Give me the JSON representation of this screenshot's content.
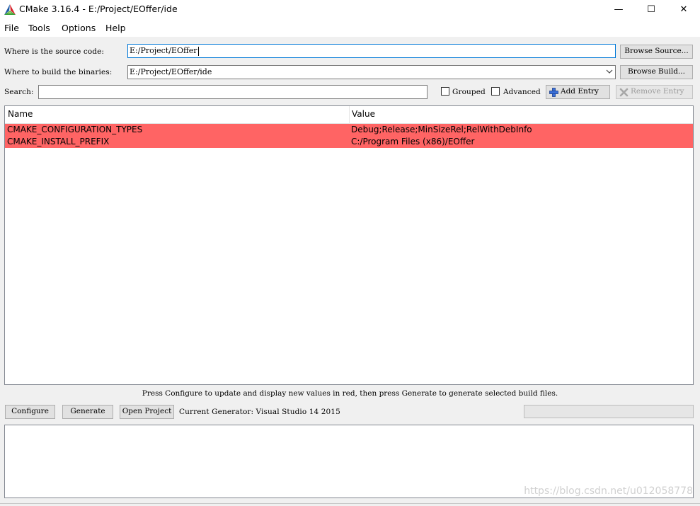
{
  "window": {
    "title": "CMake 3.16.4 - E:/Project/EOffer/ide",
    "minimize_glyph": "—",
    "maximize_glyph": "☐",
    "close_glyph": "✕"
  },
  "menu": [
    "File",
    "Tools",
    "Options",
    "Help"
  ],
  "source": {
    "label": "Where is the source code:",
    "value": "E:/Project/EOffer",
    "browse_label": "Browse Source..."
  },
  "build": {
    "label": "Where to build the binaries:",
    "value": "E:/Project/EOffer/ide",
    "browse_label": "Browse Build..."
  },
  "search": {
    "label": "Search:",
    "value": "",
    "grouped_label": "Grouped",
    "grouped_checked": false,
    "advanced_label": "Advanced",
    "advanced_checked": false,
    "add_entry_label": "Add Entry",
    "remove_entry_label": "Remove Entry"
  },
  "table": {
    "columns": [
      "Name",
      "Value"
    ],
    "rows": [
      {
        "name": "CMAKE_CONFIGURATION_TYPES",
        "value": "Debug;Release;MinSizeRel;RelWithDebInfo"
      },
      {
        "name": "CMAKE_INSTALL_PREFIX",
        "value": "C:/Program Files (x86)/EOffer"
      }
    ],
    "new_row_color": "#ff6464"
  },
  "hint": "Press Configure to update and display new values in red,  then press Generate to generate selected build files.",
  "actions": {
    "configure_label": "Configure",
    "generate_label": "Generate",
    "open_project_label": "Open Project",
    "current_generator": "Current Generator: Visual Studio 14 2015"
  },
  "progress": 0,
  "output_text": "",
  "watermark": "https://blog.csdn.net/u012058778",
  "colors": {
    "focus_border": "#0078d7",
    "new_entry_background": "#ff6464",
    "window_background": "#f0f0f0"
  }
}
